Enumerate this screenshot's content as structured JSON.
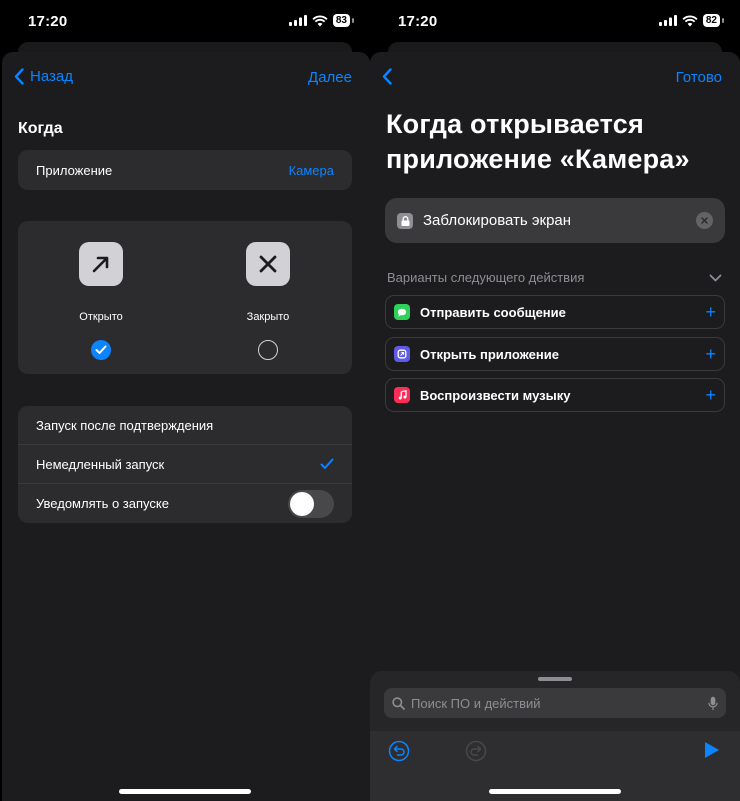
{
  "left_screen": {
    "status": {
      "time": "17:20",
      "battery": "83"
    },
    "nav": {
      "back_label": "Назад",
      "next_label": "Далее"
    },
    "section_title": "Когда",
    "app_row": {
      "label": "Приложение",
      "value": "Камера"
    },
    "states": {
      "opened": {
        "label": "Открыто",
        "selected": true
      },
      "closed": {
        "label": "Закрыто",
        "selected": false
      }
    },
    "options": [
      {
        "label": "Запуск после подтверждения",
        "checked": false
      },
      {
        "label": "Немедленный запуск",
        "checked": true
      },
      {
        "label": "Уведомлять о запуске",
        "toggle": false
      }
    ]
  },
  "right_screen": {
    "status": {
      "time": "17:20",
      "battery": "82"
    },
    "nav": {
      "done_label": "Готово"
    },
    "title": "Когда открывается приложение «Камера»",
    "action": {
      "label": "Заблокировать экран"
    },
    "suggestions_header": "Варианты следующего действия",
    "suggestions": [
      {
        "label": "Отправить сообщение",
        "icon": "messages-icon",
        "color": "#30d158"
      },
      {
        "label": "Открыть приложение",
        "icon": "open-app-icon",
        "color": "#5e5ce6"
      },
      {
        "label": "Воспроизвести музыку",
        "icon": "music-icon",
        "color": "#ff2d55"
      }
    ],
    "search": {
      "placeholder": "Поиск ПО и действий"
    }
  },
  "colors": {
    "accent": "#0a84ff",
    "sheet": "#1c1c1e",
    "card": "#2c2c2e"
  }
}
